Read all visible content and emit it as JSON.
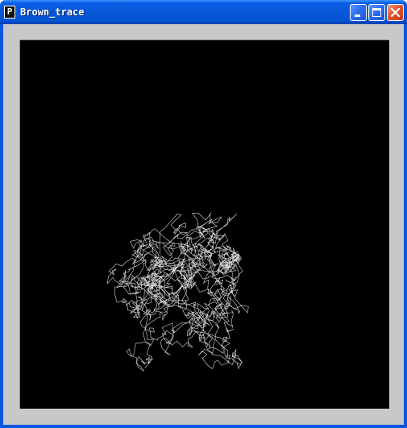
{
  "window": {
    "title": "Brown_trace",
    "icon": "processing-app-icon",
    "icon_glyph": "P",
    "buttons": {
      "minimize": "minimize-icon",
      "maximize": "maximize-icon",
      "close": "close-icon"
    }
  },
  "canvas": {
    "background": "#000000",
    "trace_color": "#ffffff",
    "frame_color": "#c8c8c8"
  }
}
